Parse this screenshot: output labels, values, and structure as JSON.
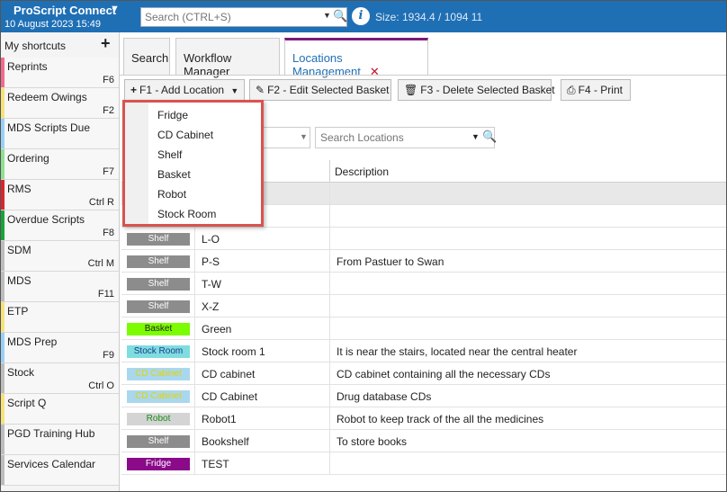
{
  "app": {
    "name": "ProScript Connect",
    "date": "10 August 2023 15:49",
    "search_placeholder": "Search (CTRL+S)",
    "size_text": "Size: 1934.4 / 1094  11"
  },
  "shortcuts": {
    "header": "My shortcuts",
    "items": [
      {
        "label": "Reprints",
        "key": "F6",
        "color": "#f26b8a"
      },
      {
        "label": "Redeem Owings",
        "key": "F2",
        "color": "#f6e27a"
      },
      {
        "label": "MDS Scripts Due",
        "key": "",
        "color": "#9ad0f5"
      },
      {
        "label": "Ordering",
        "key": "F7",
        "color": "#8fe08f"
      },
      {
        "label": "RMS",
        "key": "Ctrl R",
        "color": "#d9262e"
      },
      {
        "label": "Overdue Scripts",
        "key": "F8",
        "color": "#1aa33a"
      },
      {
        "label": "SDM",
        "key": "Ctrl M",
        "color": "#bdbdbd"
      },
      {
        "label": "MDS",
        "key": "F11",
        "color": "#bdbdbd"
      },
      {
        "label": "ETP",
        "key": "",
        "color": "#f6e27a"
      },
      {
        "label": "MDS Prep",
        "key": "F9",
        "color": "#9ad0f5"
      },
      {
        "label": "Stock",
        "key": "Ctrl O",
        "color": "#bdbdbd"
      },
      {
        "label": "Script Q",
        "key": "",
        "color": "#f6e27a"
      },
      {
        "label": "PGD Training Hub",
        "key": "",
        "color": "#bdbdbd"
      },
      {
        "label": "Services Calendar",
        "key": "",
        "color": "#bdbdbd"
      }
    ]
  },
  "tabs": [
    {
      "label": "Search"
    },
    {
      "label": "Workflow Manager"
    },
    {
      "label": "Locations Management"
    }
  ],
  "toolbar": {
    "add": "F1 - Add Location",
    "edit": "F2 - Edit Selected Basket",
    "delete": "F3 - Delete Selected Basket",
    "print": "F4 - Print"
  },
  "filter": {
    "search_placeholder": "Search Locations"
  },
  "grid": {
    "columns": [
      "",
      "e",
      "Description"
    ],
    "rows": [
      {
        "type": "",
        "name": "",
        "desc": "",
        "badge_bg": "",
        "badge_fg": ""
      },
      {
        "type": "",
        "name": "",
        "desc": "",
        "badge_bg": "",
        "badge_fg": ""
      },
      {
        "type": "Shelf",
        "name": "L-O",
        "desc": "",
        "badge_bg": "#8c8c8c",
        "badge_fg": "#ffffff"
      },
      {
        "type": "Shelf",
        "name": "P-S",
        "desc": "From Pastuer to Swan",
        "badge_bg": "#8c8c8c",
        "badge_fg": "#ffffff"
      },
      {
        "type": "Shelf",
        "name": "T-W",
        "desc": "",
        "badge_bg": "#8c8c8c",
        "badge_fg": "#ffffff"
      },
      {
        "type": "Shelf",
        "name": "X-Z",
        "desc": "",
        "badge_bg": "#8c8c8c",
        "badge_fg": "#ffffff"
      },
      {
        "type": "Basket",
        "name": "Green",
        "desc": "",
        "badge_bg": "#7cfc00",
        "badge_fg": "#222222"
      },
      {
        "type": "Stock Room",
        "name": "Stock room 1",
        "desc": "It is near the stairs, located near the central heater",
        "badge_bg": "#7fdde0",
        "badge_fg": "#1a3a8a"
      },
      {
        "type": "CD Cabinet",
        "name": "CD cabinet",
        "desc": "CD cabinet containing all the necessary CDs",
        "badge_bg": "#a9d8ee",
        "badge_fg": "#e6d200"
      },
      {
        "type": "CD Cabinet",
        "name": "CD Cabinet",
        "desc": "Drug database CDs",
        "badge_bg": "#a9d8ee",
        "badge_fg": "#e6d200"
      },
      {
        "type": "Robot",
        "name": "Robot1",
        "desc": "Robot to keep track of the all the medicines",
        "badge_bg": "#d4d4d4",
        "badge_fg": "#1a8a1a"
      },
      {
        "type": "Shelf",
        "name": "Bookshelf",
        "desc": "To store books",
        "badge_bg": "#8c8c8c",
        "badge_fg": "#ffffff"
      },
      {
        "type": "Fridge",
        "name": "TEST",
        "desc": "",
        "badge_bg": "#8a0a8a",
        "badge_fg": "#ffffff"
      }
    ]
  },
  "dropdown": {
    "items": [
      "Fridge",
      "CD Cabinet",
      "Shelf",
      "Basket",
      "Robot",
      "Stock Room"
    ]
  }
}
